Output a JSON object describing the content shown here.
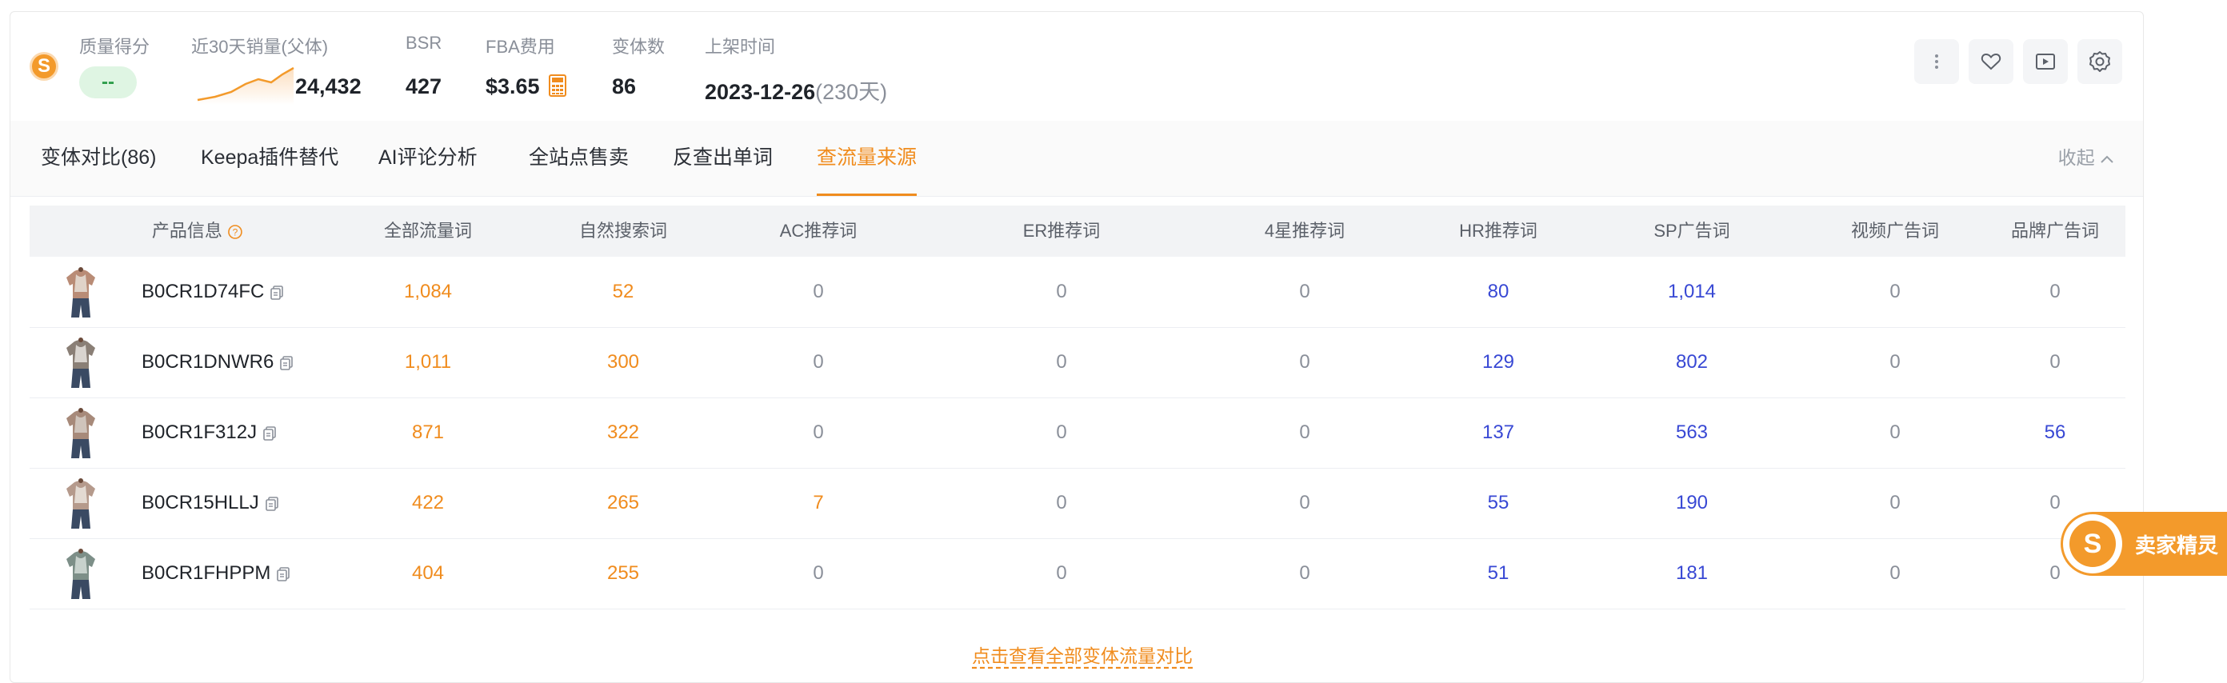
{
  "header": {
    "logo_glyph": "S",
    "quality": {
      "label": "质量得分",
      "value": "--"
    },
    "sales30": {
      "label": "近30天销量(父体)",
      "value": "24,432"
    },
    "bsr": {
      "label": "BSR",
      "value": "427"
    },
    "fba": {
      "label": "FBA费用",
      "value": "$3.65"
    },
    "variants": {
      "label": "变体数",
      "value": "86"
    },
    "listed": {
      "label": "上架时间",
      "date": "2023-12-26",
      "days": "(230天)"
    },
    "actions": [
      "more-icon",
      "heart-icon",
      "video-play-icon",
      "gear-icon"
    ]
  },
  "tabs": [
    {
      "label": "变体对比(86)",
      "active": false
    },
    {
      "label": "Keepa插件替代",
      "active": false
    },
    {
      "label": "AI评论分析",
      "active": false
    },
    {
      "label": "全站点售卖",
      "active": false
    },
    {
      "label": "反查出单词",
      "active": false
    },
    {
      "label": "查流量来源",
      "active": true
    }
  ],
  "collapse_label": "收起",
  "table": {
    "headers": [
      "产品信息",
      "全部流量词",
      "自然搜索词",
      "AC推荐词",
      "ER推荐词",
      "4星推荐词",
      "HR推荐词",
      "SP广告词",
      "视频广告词",
      "品牌广告词"
    ],
    "rows": [
      {
        "asin": "B0CR1D74FC",
        "values": [
          "1,084",
          "52",
          "0",
          "0",
          "0",
          "80",
          "1,014",
          "0",
          "0"
        ]
      },
      {
        "asin": "B0CR1DNWR6",
        "values": [
          "1,011",
          "300",
          "0",
          "0",
          "0",
          "129",
          "802",
          "0",
          "0"
        ]
      },
      {
        "asin": "B0CR1F312J",
        "values": [
          "871",
          "322",
          "0",
          "0",
          "0",
          "137",
          "563",
          "0",
          "56"
        ]
      },
      {
        "asin": "B0CR15HLLJ",
        "values": [
          "422",
          "265",
          "7",
          "0",
          "0",
          "55",
          "190",
          "0",
          "0"
        ]
      },
      {
        "asin": "B0CR1FHPPM",
        "values": [
          "404",
          "255",
          "0",
          "0",
          "0",
          "51",
          "181",
          "0",
          "0"
        ]
      }
    ]
  },
  "footer_link": "点击查看全部变体流量对比",
  "float_badge": {
    "label": "卖家精灵",
    "glyph": "S"
  },
  "colors": {
    "accent": "#f08c1e",
    "link_blue": "#3848d4",
    "muted": "#8a8f99"
  }
}
